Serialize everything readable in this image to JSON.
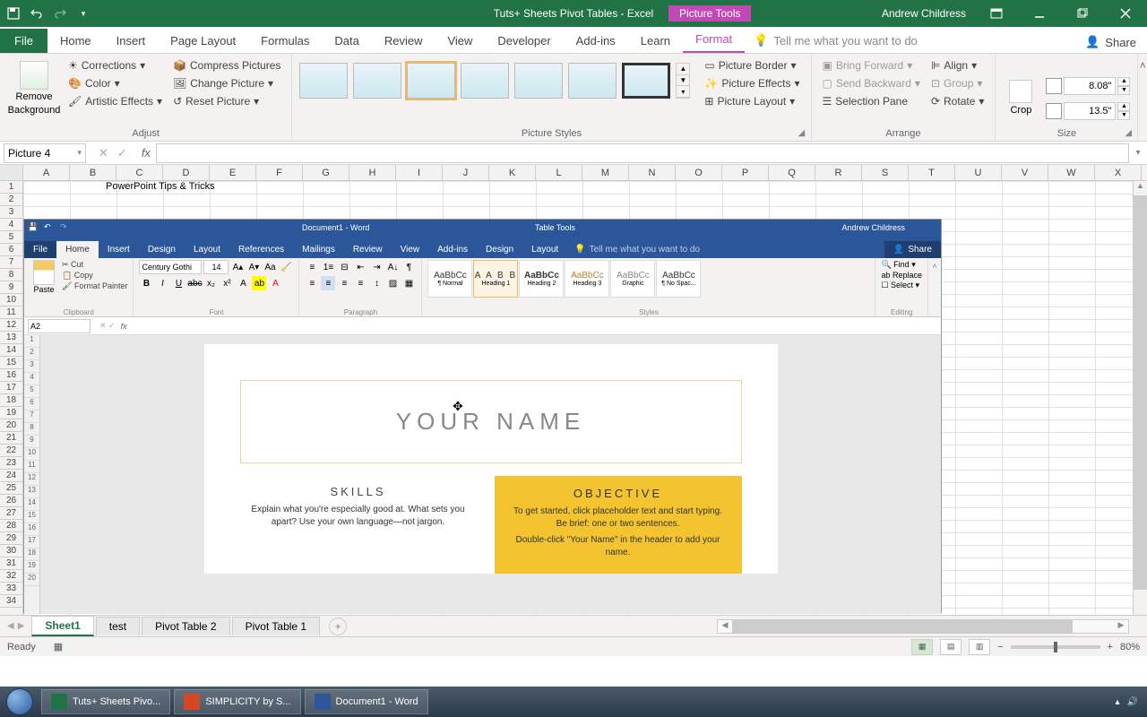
{
  "titlebar": {
    "app_title": "Tuts+ Sheets Pivot Tables  -  Excel",
    "context_tab": "Picture Tools",
    "user_name": "Andrew Childress"
  },
  "ribbon_tabs": [
    "File",
    "Home",
    "Insert",
    "Page Layout",
    "Formulas",
    "Data",
    "Review",
    "View",
    "Developer",
    "Add-ins",
    "Learn",
    "Format"
  ],
  "ribbon_active_tab": "Format",
  "tell_me_placeholder": "Tell me what you want to do",
  "share_label": "Share",
  "ribbon": {
    "adjust": {
      "label": "Adjust",
      "remove_bg_top": "Remove",
      "remove_bg_bot": "Background",
      "corrections": "Corrections",
      "color": "Color",
      "artistic": "Artistic Effects",
      "compress": "Compress Pictures",
      "change": "Change Picture",
      "reset": "Reset Picture"
    },
    "picture_styles": {
      "label": "Picture Styles",
      "border": "Picture Border",
      "effects": "Picture Effects",
      "layout": "Picture Layout"
    },
    "arrange": {
      "label": "Arrange",
      "bring_forward": "Bring Forward",
      "send_backward": "Send Backward",
      "selection_pane": "Selection Pane",
      "align": "Align",
      "group": "Group",
      "rotate": "Rotate"
    },
    "size": {
      "label": "Size",
      "crop": "Crop",
      "height": "8.08\"",
      "width": "13.5\""
    }
  },
  "formula_bar": {
    "name_box": "Picture 4"
  },
  "columns": [
    "A",
    "B",
    "C",
    "D",
    "E",
    "F",
    "G",
    "H",
    "I",
    "J",
    "K",
    "L",
    "M",
    "N",
    "O",
    "P",
    "Q",
    "R",
    "S",
    "T",
    "U",
    "V",
    "W",
    "X"
  ],
  "row_count": 34,
  "cells": {
    "c3_1": "PowerPoint Tips & Tricks"
  },
  "sheet_tabs": [
    "Sheet1",
    "test",
    "Pivot Table 2",
    "Pivot Table 1"
  ],
  "sheet_active": "Sheet1",
  "status": {
    "ready": "Ready",
    "zoom": "80%"
  },
  "taskbar": {
    "excel": "Tuts+ Sheets Pivo...",
    "ppt": "SIMPLICITY by S...",
    "word": "Document1 - Word"
  },
  "word": {
    "title": "Document1  -  Word",
    "context": "Table Tools",
    "user": "Andrew Childress",
    "tabs": [
      "File",
      "Home",
      "Insert",
      "Design",
      "Layout",
      "References",
      "Mailings",
      "Review",
      "View",
      "Add-ins",
      "Design",
      "Layout"
    ],
    "active_tab": "Home",
    "tell_me": "Tell me what you want to do",
    "share": "Share",
    "groups": {
      "clipboard": {
        "label": "Clipboard",
        "paste": "Paste",
        "cut": "Cut",
        "copy": "Copy",
        "format_painter": "Format Painter"
      },
      "font": {
        "label": "Font",
        "family": "Century Gothi",
        "size": "14"
      },
      "paragraph": {
        "label": "Paragraph"
      },
      "styles": {
        "label": "Styles",
        "items": [
          "¶ Normal",
          "Heading 1",
          "Heading 2",
          "Heading 3",
          "Graphic",
          "¶ No Spac..."
        ],
        "sample": "AaBbCc",
        "sample_big": "A A B B"
      },
      "editing": {
        "label": "Editing",
        "find": "Find",
        "replace": "Replace",
        "select": "Select"
      }
    },
    "name_box": "A2",
    "row_count": 20,
    "doc": {
      "your_name": "YOUR NAME",
      "skills_h": "SKILLS",
      "skills_p": "Explain what you're especially good at. What sets you apart? Use your own language—not jargon.",
      "obj_h": "OBJECTIVE",
      "obj_p1": "To get started, click placeholder text and start typing. Be brief: one or two sentences.",
      "obj_p2": "Double-click \"Your Name\" in the header to add your name."
    }
  }
}
